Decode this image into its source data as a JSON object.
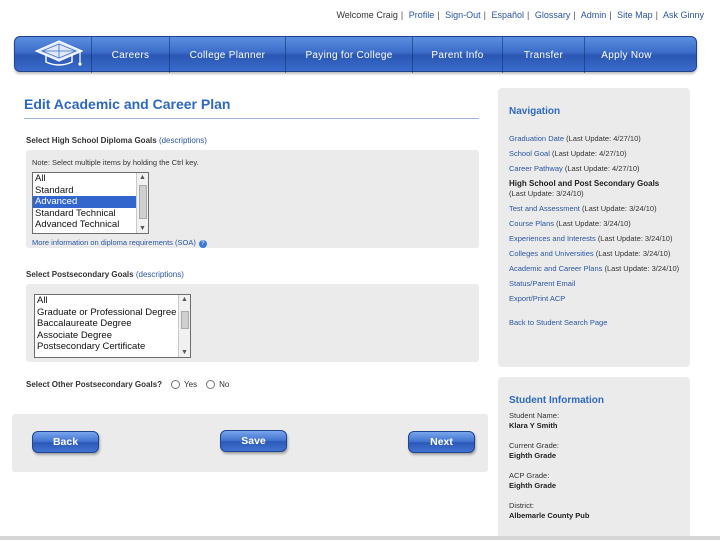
{
  "top_links": {
    "welcome": "Welcome Craig",
    "links": [
      "Profile",
      "Sign-Out",
      "Español",
      "Glossary",
      "Admin",
      "Site Map",
      "Ask Ginny"
    ]
  },
  "navbar": {
    "items": [
      "Careers",
      "College Planner",
      "Paying for College",
      "Parent Info",
      "Transfer",
      "Apply Now"
    ]
  },
  "page": {
    "title": "Edit Academic and Career Plan"
  },
  "diploma": {
    "label": "Select High School Diploma Goals",
    "desc_link": "(descriptions)",
    "note": "Note: Select multiple items by holding the Ctrl key.",
    "options": [
      "All",
      "Standard",
      "Advanced",
      "Standard Technical",
      "Advanced Technical"
    ],
    "selected": "Advanced",
    "more_info": "More information on diploma requirements (SOA)"
  },
  "postsecondary": {
    "label": "Select Postsecondary Goals",
    "desc_link": "(descriptions)",
    "options": [
      "All",
      "Graduate or Professional Degree",
      "Baccalaureate Degree",
      "Associate Degree",
      "Postsecondary Certificate"
    ]
  },
  "other_goals": {
    "label": "Select Other Postsecondary Goals?",
    "yes": "Yes",
    "no": "No"
  },
  "buttons": {
    "back": "Back",
    "save": "Save",
    "next": "Next"
  },
  "navigation": {
    "title": "Navigation",
    "items": [
      {
        "label": "Graduation Date",
        "update": "(Last Update: 4/27/10)",
        "bold": false
      },
      {
        "label": "School Goal",
        "update": "(Last Update: 4/27/10)",
        "bold": false
      },
      {
        "label": "Career Pathway",
        "update": "(Last Update: 4/27/10)",
        "bold": false
      },
      {
        "label": "High School and Post Secondary Goals",
        "update": "(Last Update: 3/24/10)",
        "bold": true
      },
      {
        "label": "Test and Assessment",
        "update": "(Last Update: 3/24/10)",
        "bold": false
      },
      {
        "label": "Course Plans",
        "update": "(Last Update: 3/24/10)",
        "bold": false
      },
      {
        "label": "Experiences and Interests",
        "update": "(Last Update: 3/24/10)",
        "bold": false
      },
      {
        "label": "Colleges and Universities",
        "update": "(Last Update: 3/24/10)",
        "bold": false
      },
      {
        "label": "Academic and Career Plans",
        "update": "(Last Update: 3/24/10)",
        "bold": false
      },
      {
        "label": "Status/Parent Email",
        "update": "",
        "bold": false
      },
      {
        "label": "Export/Print ACP",
        "update": "",
        "bold": false
      }
    ],
    "back_link": "Back to Student Search Page"
  },
  "student_info": {
    "title": "Student Information",
    "fields": [
      {
        "label": "Student Name:",
        "value": "Klara Y Smith"
      },
      {
        "label": "Current Grade:",
        "value": "Eighth Grade"
      },
      {
        "label": "ACP Grade:",
        "value": "Eighth Grade"
      },
      {
        "label": "District:",
        "value": "Albemarle County Pub"
      }
    ]
  },
  "colors": {
    "accent": "#2e68c0",
    "link": "#2a55a5",
    "nav_bar": "#3b6cc8",
    "panel": "#ebebeb"
  }
}
